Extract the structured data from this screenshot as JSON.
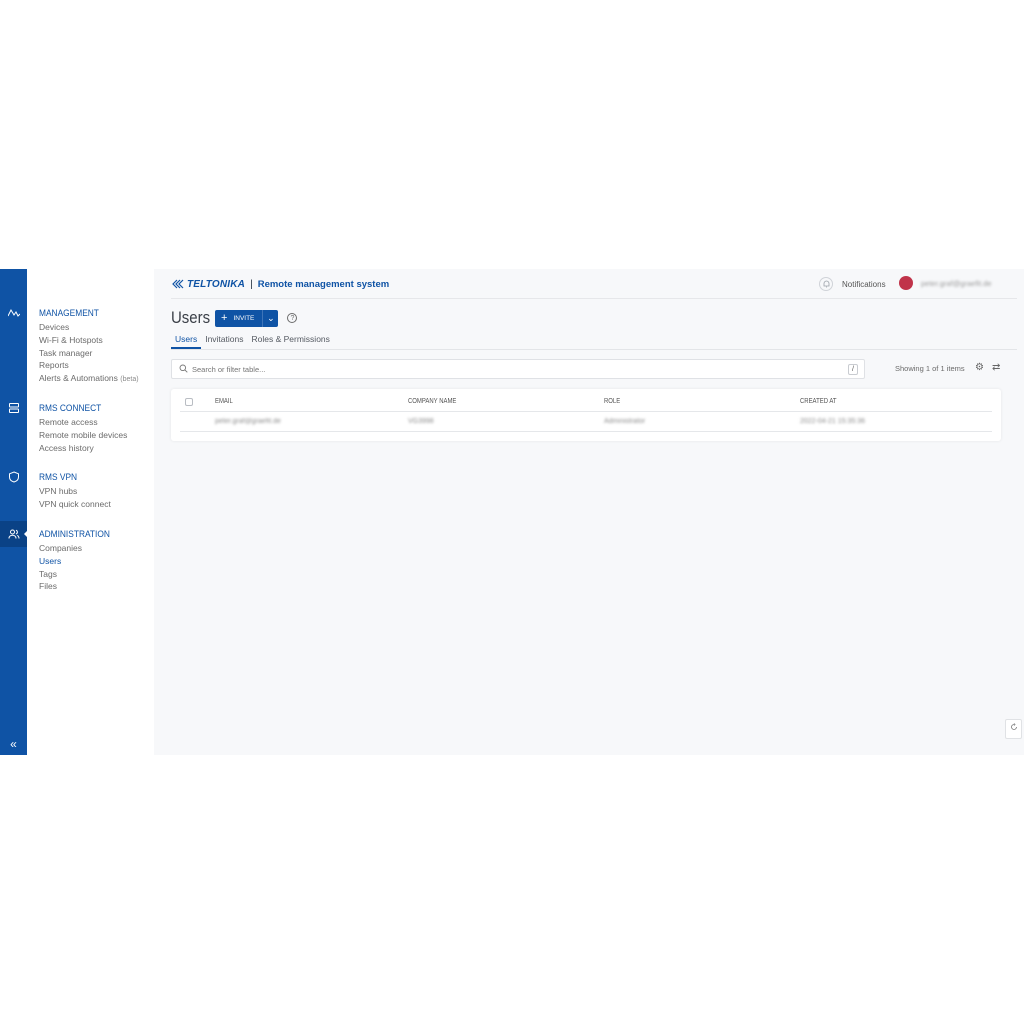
{
  "rail": {
    "icons": [
      "activity-icon",
      "server-icon",
      "shield-icon",
      "users-icon"
    ],
    "collapse": "«"
  },
  "nav": {
    "groups": [
      {
        "heading": "MANAGEMENT",
        "items": [
          "Devices",
          "Wi-Fi & Hotspots",
          "Task manager",
          "Reports",
          "Alerts & Automations"
        ],
        "suffix": "(beta)"
      },
      {
        "heading": "RMS CONNECT",
        "items": [
          "Remote access",
          "Remote mobile devices",
          "Access history"
        ]
      },
      {
        "heading": "RMS VPN",
        "items": [
          "VPN hubs",
          "VPN quick connect"
        ]
      },
      {
        "heading": "ADMINISTRATION",
        "items": [
          "Companies",
          "Users",
          "Tags",
          "Files"
        ]
      }
    ]
  },
  "header": {
    "brand": "TELTONIKA",
    "separator": "|",
    "system_name": "Remote management system",
    "notifications_label": "Notifications",
    "user_email": "peter.graf@graefit.de"
  },
  "page": {
    "title": "Users",
    "invite_label": "INVITE",
    "help": "?",
    "tabs": [
      "Users",
      "Invitations",
      "Roles & Permissions"
    ],
    "search_placeholder": "Search or filter table...",
    "search_shortcut": "/",
    "showing": "Showing 1 of 1 items"
  },
  "table": {
    "columns": [
      "EMAIL",
      "COMPANY NAME",
      "ROLE",
      "CREATED AT"
    ],
    "rows": [
      {
        "email": "peter.graf@graefit.de",
        "company": "VG3998",
        "role": "Administrator",
        "created": "2022-04-21 15:35:36"
      }
    ]
  },
  "colors": {
    "brand": "#0f53a5",
    "background": "#f7f8fa"
  }
}
